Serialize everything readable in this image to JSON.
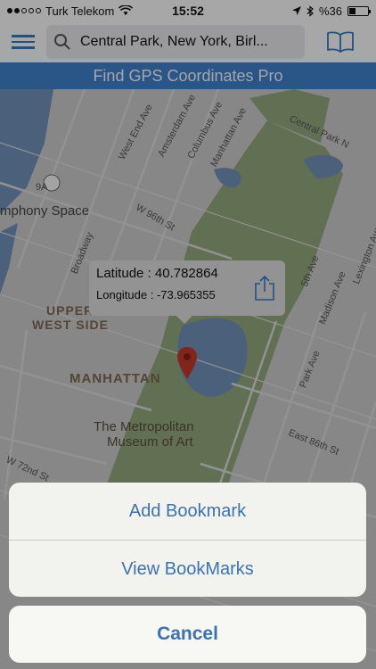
{
  "status_bar": {
    "carrier": "Turk Telekom",
    "time": "15:52",
    "battery_text": "%36",
    "battery_level": 0.36
  },
  "nav": {
    "search_value": "Central Park, New York, Birl..."
  },
  "banner": {
    "title": "Find GPS Coordinates Pro"
  },
  "map": {
    "streets": [
      {
        "text": "West End Ave",
        "name": "street-label-west-end-ave"
      },
      {
        "text": "Amsterdam Ave",
        "name": "street-label-amsterdam-ave"
      },
      {
        "text": "Columbus Ave",
        "name": "street-label-columbus-ave"
      },
      {
        "text": "Manhattan Ave",
        "name": "street-label-manhattan-ave"
      },
      {
        "text": "Central Park N",
        "name": "street-label-central-park-n"
      },
      {
        "text": "W 96th St",
        "name": "street-label-w-96th-st"
      },
      {
        "text": "Broadway",
        "name": "street-label-broadway"
      },
      {
        "text": "5th Ave",
        "name": "street-label-5th-ave"
      },
      {
        "text": "Madison Ave",
        "name": "street-label-madison-ave"
      },
      {
        "text": "Park Ave",
        "name": "street-label-park-ave"
      },
      {
        "text": "East 86th St",
        "name": "street-label-east-86th-st"
      },
      {
        "text": "W 72nd St",
        "name": "street-label-w-72nd-st"
      },
      {
        "text": "Lexington Ave",
        "name": "street-label-lexington-ave"
      }
    ],
    "highway_shield": "9A",
    "symphony_space": "mphony Space",
    "upper_west_side_1": "UPPER",
    "upper_west_side_2": "WEST SIDE",
    "manhattan": "MANHATTAN",
    "met_museum_1": "The Metropolitan",
    "met_museum_2": "Museum of Art"
  },
  "callout": {
    "latitude": "Latitude : 40.782864",
    "longitude": "Longitude : -73.965355"
  },
  "action_sheet": {
    "add_bookmark": "Add Bookmark",
    "view_bookmarks": "View BookMarks",
    "cancel": "Cancel"
  },
  "colors": {
    "accent": "#3a72b3",
    "banner": "#3d7fc7",
    "pin": "#c0392b"
  }
}
